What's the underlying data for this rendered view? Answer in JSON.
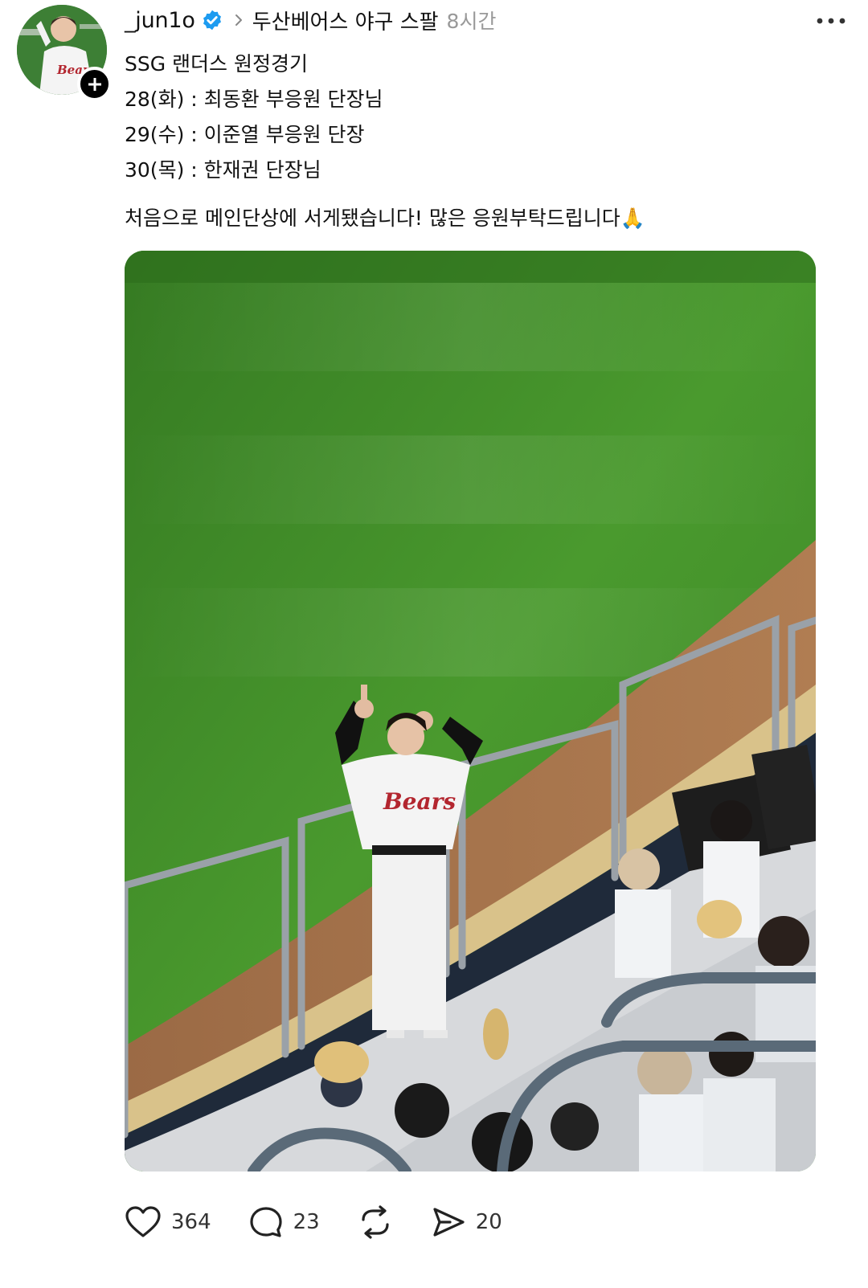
{
  "post": {
    "username": "_jun1o",
    "topic": "두산베어스 야구 스팔",
    "time": "8시간",
    "lines": [
      "SSG 랜더스 원정경기",
      "28(화) : 최동환 부응원 단장님",
      "29(수) : 이준열 부응원 단장",
      "30(목) : 한재권 단장님"
    ],
    "message": "처음으로 메인단상에 서게됐습니다! 많은 응원부탁드립니다🙏"
  },
  "actions": {
    "likes": "364",
    "comments": "23",
    "shares": "20"
  },
  "icons": {
    "verified": "verified-badge-icon",
    "follow": "plus-icon",
    "more": "more-dots-icon",
    "like": "heart-icon",
    "comment": "comment-icon",
    "repost": "repost-icon",
    "share": "send-icon"
  },
  "colors": {
    "verified": "#1d9bf0",
    "text": "#111111",
    "muted": "#999999"
  }
}
